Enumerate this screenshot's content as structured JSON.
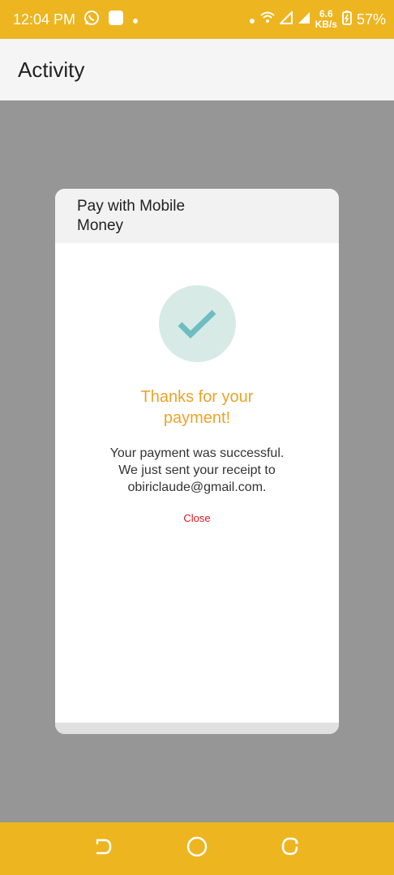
{
  "status_bar": {
    "time": "12:04 PM",
    "speed_value": "6.6",
    "speed_unit": "KB/s",
    "battery": "57%",
    "icons": [
      "whatsapp-icon",
      "app-notification-icon",
      "dot-icon",
      "dot-icon",
      "wifi-icon",
      "signal-icon",
      "signal-icon",
      "battery-icon"
    ]
  },
  "app_bar": {
    "title": "Activity"
  },
  "dialog": {
    "title": "Pay with Mobile Money",
    "thanks_line1": "Thanks for your",
    "thanks_line2": "payment!",
    "msg_line1": "Your payment was successful.",
    "msg_line2": "We just sent your receipt to",
    "msg_line3": "obiriclaude@gmail.com.",
    "close_label": "Close"
  },
  "colors": {
    "accent": "#EDB520",
    "thanks": "#EBA42A",
    "close": "#E0161E",
    "check": "#6DBDC2",
    "check_bg": "#D8EAE6",
    "overlay": "#969696"
  },
  "nav_bar": {
    "icons": [
      "back-icon",
      "home-icon",
      "recents-icon"
    ]
  }
}
